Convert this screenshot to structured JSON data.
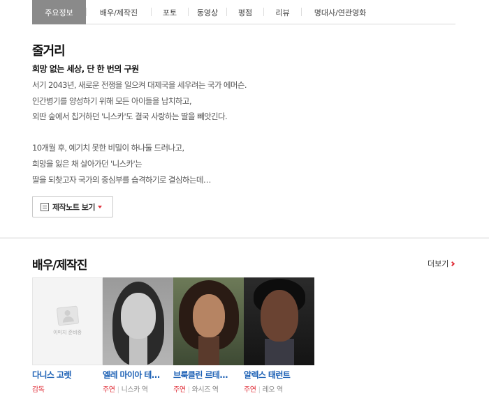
{
  "tabs": [
    {
      "label": "주요정보",
      "active": true,
      "width": 77
    },
    {
      "label": "배우/제작진",
      "active": false,
      "width": 92
    },
    {
      "label": "포토",
      "active": false,
      "width": 52
    },
    {
      "label": "동영상",
      "active": false,
      "width": 54
    },
    {
      "label": "평점",
      "active": false,
      "width": 52
    },
    {
      "label": "리뷰",
      "active": false,
      "width": 53
    },
    {
      "label": "명대사/연관영화",
      "active": false,
      "width": 110
    }
  ],
  "synopsis": {
    "title": "줄거리",
    "subtitle": "희망 없는 세상, 단 한 번의 구원",
    "lines": [
      "서기 2043년, 새로운 전쟁을 일으켜 대제국을 세우려는 국가 에머슨.",
      " 인간병기를 양성하기 위해 모든 아이들을 납치하고,",
      " 외딴 숲에서 칩거하던 '니스카'도 결국 사랑하는 딸을 빼앗긴다.",
      "",
      " 10개월 후, 예기치 못한 비밀이 하나둘 드러나고,",
      " 희망을 잃은 채 살아가던 '니스카'는",
      " 딸을 되찾고자 국가의 중심부를 습격하기로 결심하는데…"
    ],
    "note_button_label": "제작노트 보기"
  },
  "cast_section": {
    "title": "배우/제작진",
    "more_label": "더보기",
    "members": [
      {
        "name": "다니스 고렛",
        "role_type": "감독",
        "role": "",
        "photo": "placeholder",
        "placeholder_text": "이미지 준비중"
      },
      {
        "name": "엘레 마이아 테...",
        "role_type": "주연",
        "role": "니스카 역",
        "photo": "p1"
      },
      {
        "name": "브룩클린 르테...",
        "role_type": "주연",
        "role": "와시즈 역",
        "photo": "p2"
      },
      {
        "name": "알렉스 태런트",
        "role_type": "주연",
        "role": "레오 역",
        "photo": "p3"
      }
    ]
  }
}
